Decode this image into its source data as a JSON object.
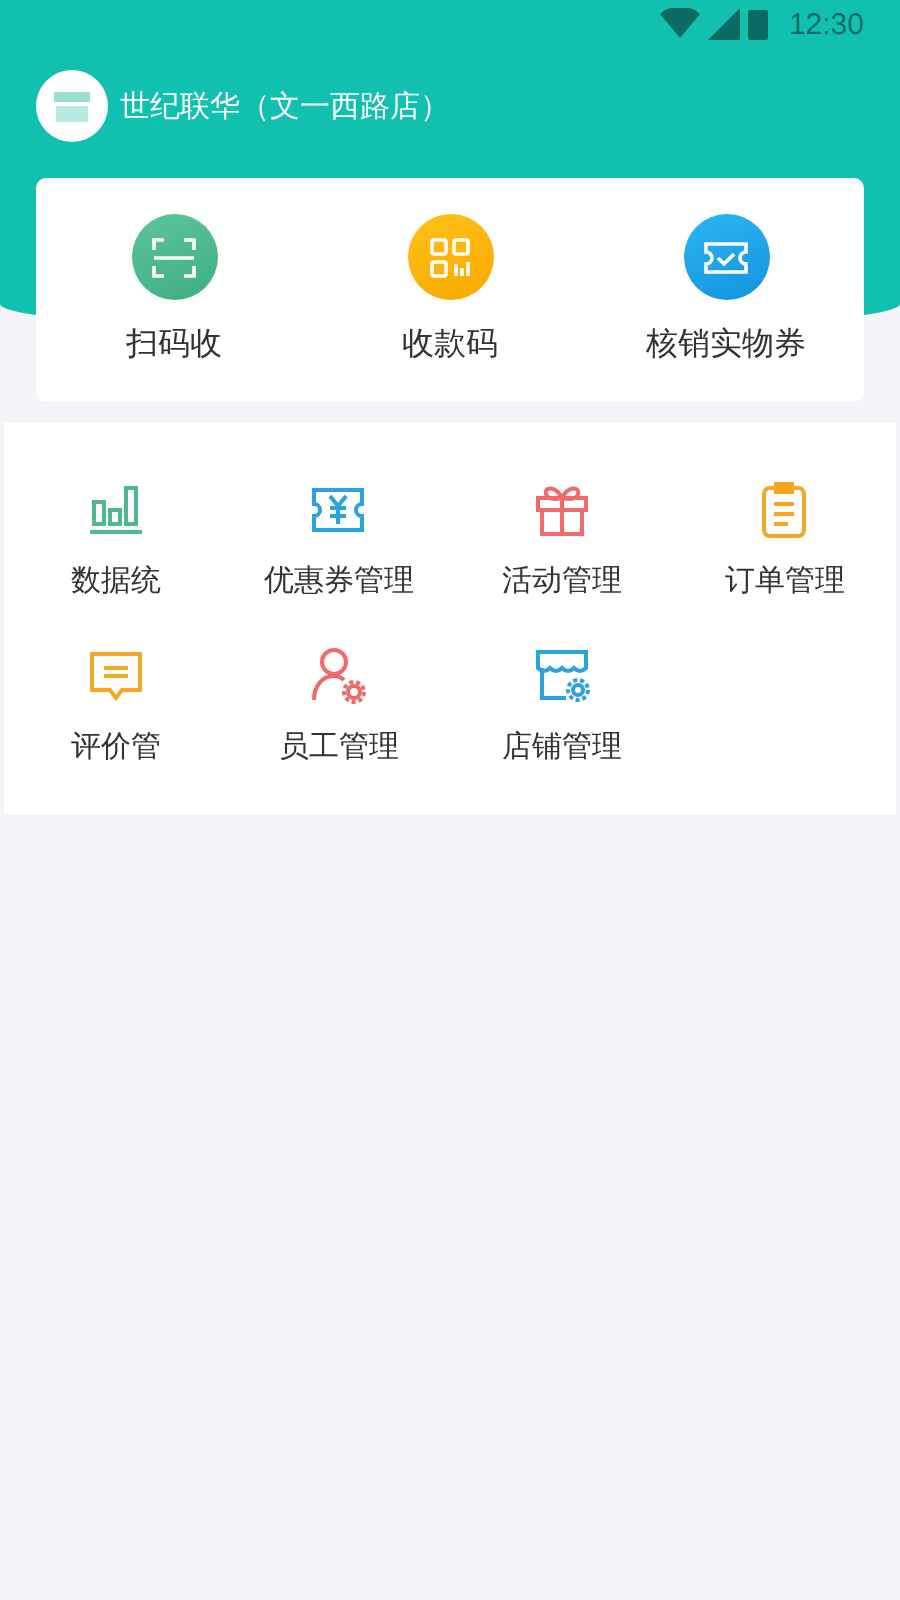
{
  "status_bar": {
    "time": "12:30"
  },
  "store": {
    "name": "世纪联华（文一西路店）"
  },
  "quick_actions": [
    {
      "label": "扫码收"
    },
    {
      "label": "收款码"
    },
    {
      "label": "核销实物券"
    }
  ],
  "menu": [
    {
      "label": "数据统"
    },
    {
      "label": "优惠券管理"
    },
    {
      "label": "活动管理"
    },
    {
      "label": "订单管理"
    },
    {
      "label": "评价管"
    },
    {
      "label": "员工管理"
    },
    {
      "label": "店铺管理"
    }
  ]
}
